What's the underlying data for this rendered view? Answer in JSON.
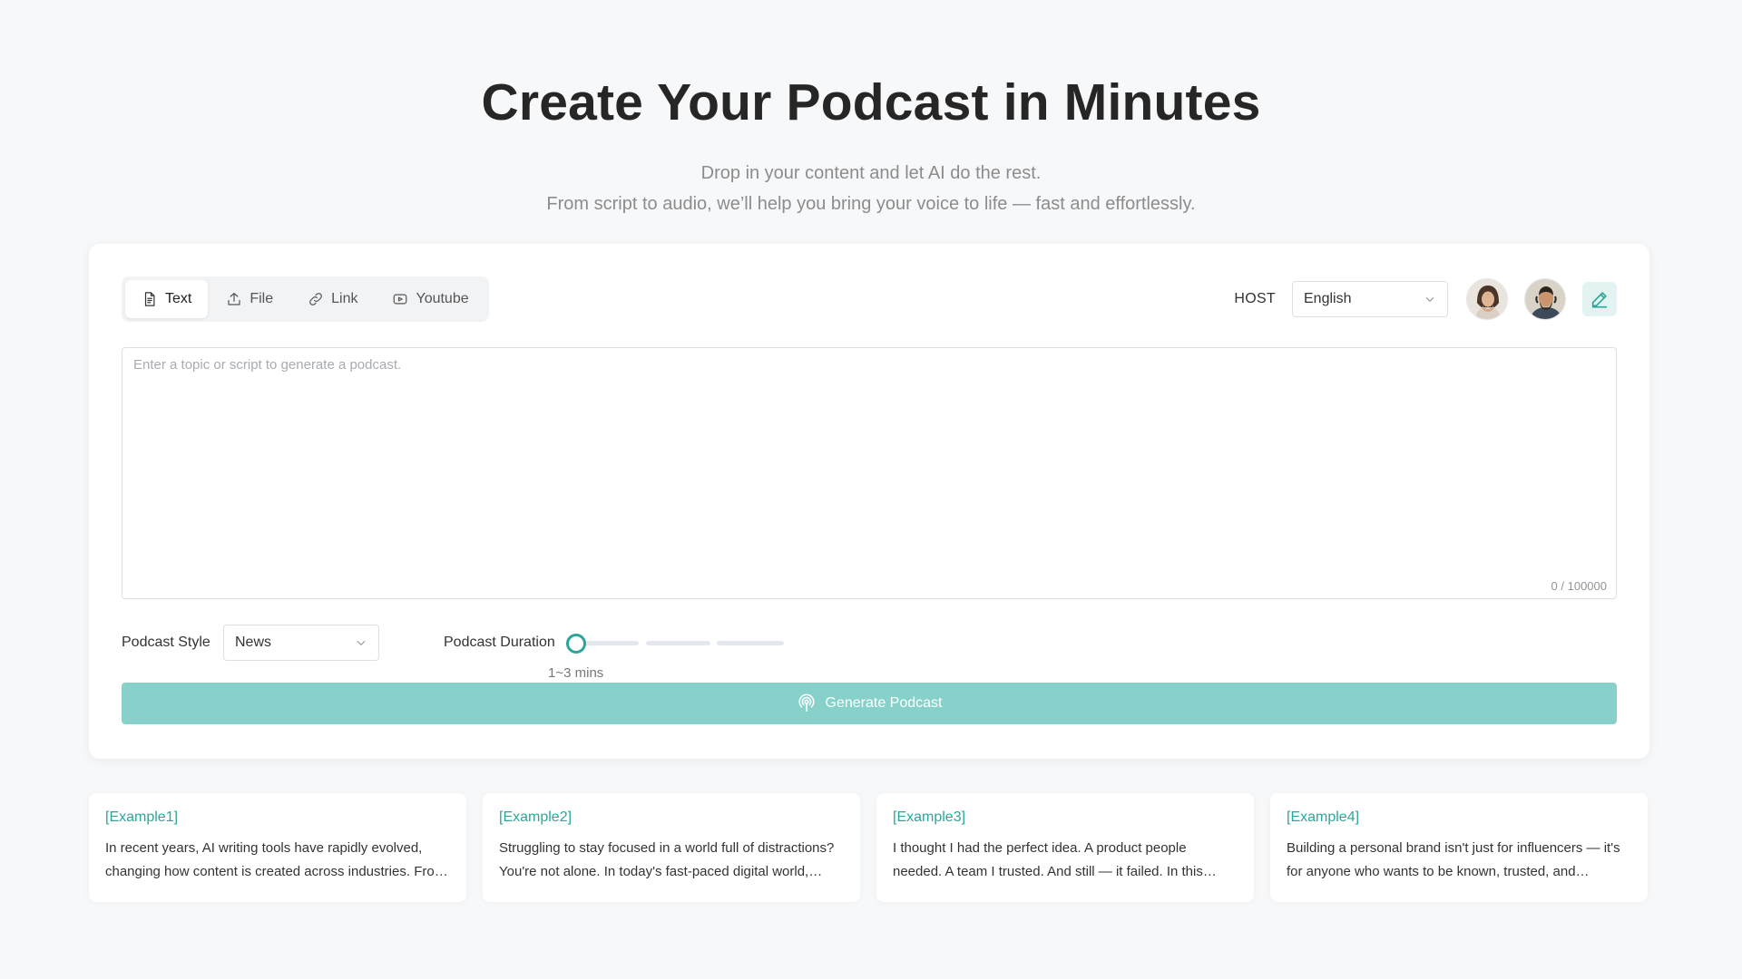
{
  "hero": {
    "title": "Create Your Podcast in Minutes",
    "subtitle_line1": "Drop in your content and let AI do the rest.",
    "subtitle_line2": "From script to audio, we’ll help you bring your voice to life — fast and effortlessly."
  },
  "tabs": [
    {
      "label": "Text",
      "icon": "document-icon",
      "active": true
    },
    {
      "label": "File",
      "icon": "upload-icon",
      "active": false
    },
    {
      "label": "Link",
      "icon": "link-icon",
      "active": false
    },
    {
      "label": "Youtube",
      "icon": "youtube-icon",
      "active": false
    }
  ],
  "host": {
    "label": "HOST",
    "language": "English",
    "avatars": [
      "female-host-avatar",
      "male-host-avatar"
    ],
    "edit_icon": "pencil-icon"
  },
  "input": {
    "placeholder": "Enter a topic or script to generate a podcast.",
    "counter": "0 / 100000"
  },
  "options": {
    "style_label": "Podcast Style",
    "style_value": "News",
    "duration_label": "Podcast Duration",
    "duration_caption": "1~3 mins",
    "duration_level": 0
  },
  "generate": {
    "label": "Generate Podcast",
    "icon": "podcast-icon"
  },
  "examples": [
    {
      "title": "[Example1]",
      "text": "In recent years, AI writing tools have rapidly evolved, changing how content is created across industries. From marketing copy to academic writing, these tools are reshaping workflows."
    },
    {
      "title": "[Example2]",
      "text": "Struggling to stay focused in a world full of distractions? You're not alone. In today's fast-paced digital world, maintaining focus has become harder than ever."
    },
    {
      "title": "[Example3]",
      "text": "I thought I had the perfect idea. A product people needed. A team I trusted. And still — it failed. In this episode, I share what went wrong."
    },
    {
      "title": "[Example4]",
      "text": "Building a personal brand isn't just for influencers — it's for anyone who wants to be known, trusted, and remembered in their field."
    }
  ],
  "colors": {
    "accent": "#2ea59a",
    "button_bg": "#88d1cb",
    "page_bg": "#f7f8fa"
  }
}
